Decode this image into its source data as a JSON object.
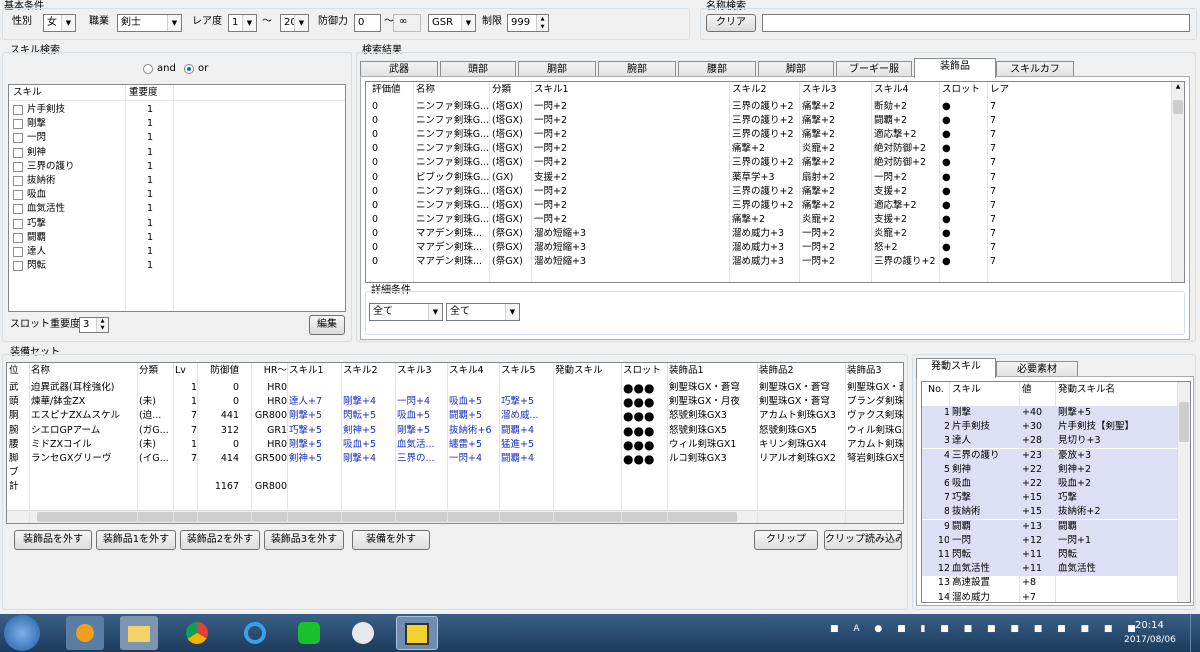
{
  "basic": {
    "title": "基本条件",
    "sex_label": "性別",
    "sex": "女",
    "job_label": "職業",
    "job": "剣士",
    "rarity_label": "レア度",
    "rarity_min": "1",
    "tilde": "〜",
    "rarity_max": "20",
    "defense_label": "防御力",
    "defense_min": "0",
    "defense_tilde": "〜",
    "infinity": "∞",
    "gsr": "GSR",
    "limit_label": "制限",
    "limit": "999"
  },
  "name_search": {
    "title": "名称検索",
    "clear": "クリア",
    "value": ""
  },
  "skill_search": {
    "title": "スキル検索",
    "and_label": "and",
    "or_label": "or",
    "col_skill": "スキル",
    "col_importance": "重要度",
    "items": [
      {
        "name": "片手剣技",
        "imp": "1"
      },
      {
        "name": "剛撃",
        "imp": "1"
      },
      {
        "name": "一閃",
        "imp": "1"
      },
      {
        "name": "剣神",
        "imp": "1"
      },
      {
        "name": "三界の護り",
        "imp": "1"
      },
      {
        "name": "抜納術",
        "imp": "1"
      },
      {
        "name": "吸血",
        "imp": "1"
      },
      {
        "name": "血気活性",
        "imp": "1"
      },
      {
        "name": "巧撃",
        "imp": "1"
      },
      {
        "name": "闘覇",
        "imp": "1"
      },
      {
        "name": "達人",
        "imp": "1"
      },
      {
        "name": "閃転",
        "imp": "1"
      }
    ],
    "slot_importance_label": "スロット重要度",
    "slot_importance": "3",
    "edit": "編集"
  },
  "results": {
    "title": "検索結果",
    "tabs": [
      "武器",
      "頭部",
      "胴部",
      "腕部",
      "腰部",
      "脚部",
      "ブーギー服",
      "装飾品",
      "スキルカフ"
    ],
    "active_tab": 7,
    "headers": [
      "評価値",
      "名称",
      "分類",
      "スキル1",
      "スキル2",
      "スキル3",
      "スキル4",
      "スロット",
      "レア"
    ],
    "rows": [
      [
        "0",
        "ニンファ剣珠G...",
        "(塔GX)",
        "一閃+2",
        "三界の護り+2",
        "痛撃+2",
        "断劾+2",
        "●",
        "7"
      ],
      [
        "0",
        "ニンファ剣珠G...",
        "(塔GX)",
        "一閃+2",
        "三界の護り+2",
        "痛撃+2",
        "闘覇+2",
        "●",
        "7"
      ],
      [
        "0",
        "ニンファ剣珠G...",
        "(塔GX)",
        "一閃+2",
        "三界の護り+2",
        "痛撃+2",
        "適応撃+2",
        "●",
        "7"
      ],
      [
        "0",
        "ニンファ剣珠G...",
        "(塔GX)",
        "一閃+2",
        "痛撃+2",
        "炎寵+2",
        "絶対防御+2",
        "●",
        "7"
      ],
      [
        "0",
        "ニンファ剣珠G...",
        "(塔GX)",
        "一閃+2",
        "三界の護り+2",
        "痛撃+2",
        "絶対防御+2",
        "●",
        "7"
      ],
      [
        "0",
        "ビブック剣珠G...",
        "(GX)",
        "支援+2",
        "薬草学+3",
        "扇射+2",
        "一閃+2",
        "●",
        "7"
      ],
      [
        "0",
        "ニンファ剣珠G...",
        "(塔GX)",
        "一閃+2",
        "三界の護り+2",
        "痛撃+2",
        "支援+2",
        "●",
        "7"
      ],
      [
        "0",
        "ニンファ剣珠G...",
        "(塔GX)",
        "一閃+2",
        "三界の護り+2",
        "痛撃+2",
        "適応撃+2",
        "●",
        "7"
      ],
      [
        "0",
        "ニンファ剣珠G...",
        "(塔GX)",
        "一閃+2",
        "痛撃+2",
        "炎寵+2",
        "支援+2",
        "●",
        "7"
      ],
      [
        "0",
        "マアデン剣珠...",
        "(祭GX)",
        "溜め短縮+3",
        "溜め威力+3",
        "一閃+2",
        "炎寵+2",
        "●",
        "7"
      ],
      [
        "0",
        "マアデン剣珠...",
        "(祭GX)",
        "溜め短縮+3",
        "溜め威力+3",
        "一閃+2",
        "怒+2",
        "●",
        "7"
      ],
      [
        "0",
        "マアデン剣珠...",
        "(祭GX)",
        "溜め短縮+3",
        "溜め威力+3",
        "一閃+2",
        "三界の護り+2",
        "●",
        "7"
      ]
    ],
    "detail_title": "詳細条件",
    "detail_combo1": "全て",
    "detail_combo2": "全て"
  },
  "equip": {
    "title": "装備セット",
    "headers": [
      "位",
      "名称",
      "分類",
      "Lv",
      "防御値",
      "HR〜",
      "スキル1",
      "スキル2",
      "スキル3",
      "スキル4",
      "スキル5",
      "発動スキル",
      "スロット",
      "装飾品1",
      "装飾品2",
      "装飾品3"
    ],
    "rows": [
      [
        "武",
        "迫異武器(耳栓強化)",
        "",
        "1",
        "0",
        "HR0",
        "",
        "",
        "",
        "",
        "",
        "",
        "●●●",
        "剣聖珠GX・蒼穹",
        "剣聖珠GX・蒼穹",
        "剣聖珠GX・蒼"
      ],
      [
        "頭",
        "煉華/鉢金ZX",
        "(未)",
        "1",
        "0",
        "HR0",
        "達人+7",
        "剛撃+4",
        "一閃+4",
        "吸血+5",
        "巧撃+5",
        "",
        "●●●",
        "剣聖珠GX・月夜",
        "剣聖珠GX・蒼穹",
        "ブランダ剣珠G"
      ],
      [
        "胴",
        "エスピナZXムスケル",
        "(迫...",
        "7",
        "441",
        "GR800",
        "剛撃+5",
        "閃転+5",
        "吸血+5",
        "闘覇+5",
        "溜め威...",
        "",
        "●●●",
        "怒號剣珠GX3",
        "アカムト剣珠GX3",
        "ヴァクス剣珠G"
      ],
      [
        "腕",
        "シエロGPアーム",
        "(ガG...",
        "7",
        "312",
        "GR1",
        "巧撃+5",
        "剣神+5",
        "剛撃+5",
        "抜納術+6",
        "闘覇+4",
        "",
        "●●●",
        "怒號剣珠GX5",
        "怒號剣珠GX5",
        "ウィル剣珠GX"
      ],
      [
        "腰",
        "ミドZXコイル",
        "(未)",
        "1",
        "0",
        "HR0",
        "剛撃+5",
        "吸血+5",
        "血気活...",
        "纏雷+5",
        "猛進+5",
        "",
        "●●●",
        "ウィル剣珠GX1",
        "キリン剣珠GX4",
        "アカムト剣珠"
      ],
      [
        "脚",
        "ランセGXグリーヴ",
        "(イG...",
        "7",
        "414",
        "GR500",
        "剣神+5",
        "剛撃+4",
        "三界の...",
        "一閃+4",
        "闘覇+4",
        "",
        "●●●",
        "ルコ剣珠GX3",
        "リアルオ剣珠GX2",
        "弩岩剣珠GX5"
      ],
      [
        "ブ",
        "",
        "",
        "",
        "",
        "",
        "",
        "",
        "",
        "",
        "",
        "",
        "",
        "",
        "",
        ""
      ],
      [
        "計",
        "",
        "",
        "",
        "1167",
        "GR800",
        "",
        "",
        "",
        "",
        "",
        "",
        "",
        "",
        "",
        ""
      ]
    ],
    "buttons": [
      "装飾品を外す",
      "装飾品1を外す",
      "装飾品2を外す",
      "装飾品3を外す",
      "装備を外す",
      "クリップ",
      "クリップ読み込み"
    ]
  },
  "skills_panel": {
    "tabs": [
      "発動スキル",
      "必要素材"
    ],
    "headers": [
      "No.",
      "スキル",
      "値",
      "発動スキル名"
    ],
    "rows": [
      [
        "1",
        "剛撃",
        "+40",
        "剛撃+5"
      ],
      [
        "2",
        "片手剣技",
        "+30",
        "片手剣技【剣聖】"
      ],
      [
        "3",
        "達人",
        "+28",
        "見切り+3"
      ],
      [
        "4",
        "三界の護り",
        "+23",
        "豪放+3"
      ],
      [
        "5",
        "剣神",
        "+22",
        "剣神+2"
      ],
      [
        "6",
        "吸血",
        "+22",
        "吸血+2"
      ],
      [
        "7",
        "巧撃",
        "+15",
        "巧撃"
      ],
      [
        "8",
        "抜納術",
        "+15",
        "抜納術+2"
      ],
      [
        "9",
        "闘覇",
        "+13",
        "闘覇"
      ],
      [
        "10",
        "一閃",
        "+12",
        "一閃+1"
      ],
      [
        "11",
        "閃転",
        "+11",
        "閃転"
      ],
      [
        "12",
        "血気活性",
        "+11",
        "血気活性"
      ],
      [
        "13",
        "高速設置",
        "+8",
        ""
      ],
      [
        "14",
        "溜め威力",
        "+7",
        ""
      ]
    ]
  },
  "taskbar": {
    "time": "20:14",
    "date": "2017/08/06"
  },
  "colors": {
    "selection": "#dde0f5",
    "skill_blue": "#1a2ec4",
    "taskbar": "#1c3b5c"
  }
}
